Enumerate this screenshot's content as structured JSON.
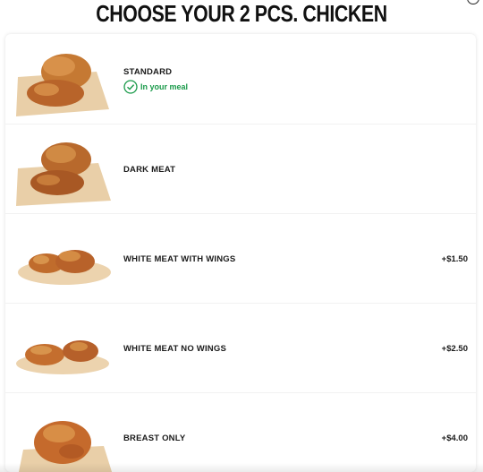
{
  "page": {
    "title": "CHOOSE YOUR 2 PCS. CHICKEN"
  },
  "options": [
    {
      "label": "STANDARD",
      "price": "",
      "badge": "In your meal"
    },
    {
      "label": "DARK MEAT",
      "price": ""
    },
    {
      "label": "WHITE MEAT WITH WINGS",
      "price": "+$1.50"
    },
    {
      "label": "WHITE MEAT NO WINGS",
      "price": "+$2.50"
    },
    {
      "label": "BREAST ONLY",
      "price": "+$4.00"
    }
  ],
  "colors": {
    "accent_green": "#1a9a4a",
    "chicken": "#c8742e",
    "paper": "#e8c9a2"
  }
}
